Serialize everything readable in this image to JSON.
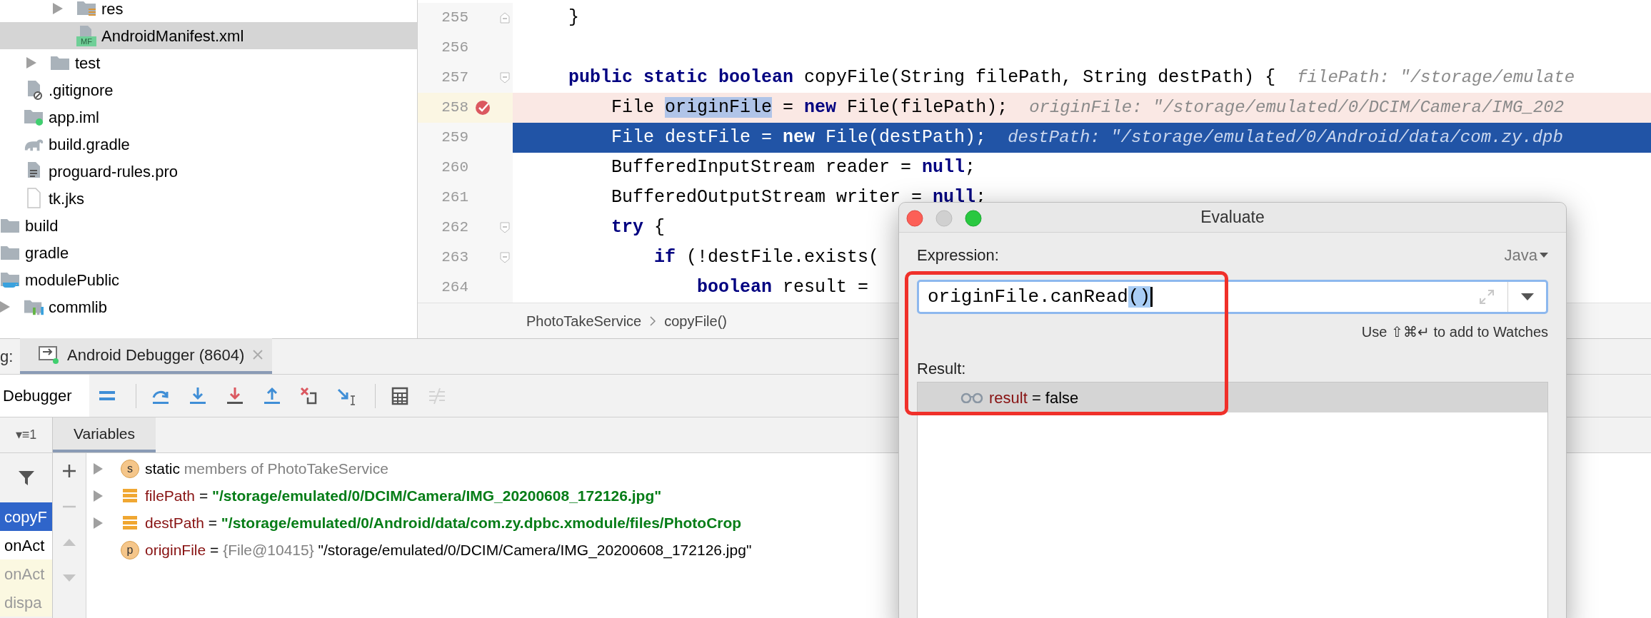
{
  "project_tree": [
    {
      "children": [
        {
          "children": [
            {
              "children": [
                {
                  "label": "res",
                  "kind": "res-folder",
                  "expanded": false,
                  "selected": false
                },
                {
                  "label": "AndroidManifest.xml",
                  "kind": "manifest",
                  "badge": "MF",
                  "selected": true
                }
              ]
            },
            {
              "label": "test",
              "kind": "folder",
              "expanded": false,
              "selected": false
            }
          ]
        },
        {
          "label": ".gitignore",
          "kind": "ignore-file",
          "selected": false
        },
        {
          "label": "app.iml",
          "kind": "module-file",
          "selected": false
        },
        {
          "label": "build.gradle",
          "kind": "gradle",
          "selected": false
        },
        {
          "label": "proguard-rules.pro",
          "kind": "text-file",
          "selected": false
        },
        {
          "label": "tk.jks",
          "kind": "blank-file",
          "selected": false
        }
      ]
    },
    {
      "label": "build",
      "kind": "folder",
      "selected": false
    },
    {
      "label": "gradle",
      "kind": "folder",
      "selected": false
    },
    {
      "label": "modulePublic",
      "kind": "module-folder",
      "selected": false,
      "children": [
        {
          "label": "commlib",
          "kind": "library-folder",
          "expanded": false,
          "selected": false
        }
      ]
    }
  ],
  "editor": {
    "lines": [
      {
        "number": "255",
        "kind": "normal",
        "fold_start": false,
        "fold_end": true,
        "parts": [
          {
            "text": "    }",
            "highlighted": false
          }
        ]
      },
      {
        "number": "256",
        "kind": "normal",
        "fold_start": false,
        "fold_end": false
      },
      {
        "number": "257",
        "kind": "normal",
        "fold_start": true,
        "fold_end": false,
        "parts": [
          {
            "text": "    **public static boolean** copyFile(String filePath, String destPath) {",
            "highlighted": false
          }
        ],
        "hint": "filePath: \"/storage/emulate"
      },
      {
        "number": "258",
        "kind": "breakpoint",
        "fold_start": false,
        "fold_end": false,
        "parts": [
          {
            "text": "        File ",
            "highlighted": false
          },
          {
            "text": "originFile",
            "highlighted": true
          },
          {
            "text": " = **new** File(filePath);",
            "highlighted": false
          }
        ],
        "hint": "originFile: \"/storage/emulated/0/DCIM/Camera/IMG_202"
      },
      {
        "number": "259",
        "kind": "current",
        "fold_start": false,
        "fold_end": false,
        "parts": [
          {
            "text": "        File destFile = **new** File(destPath);",
            "highlighted": false
          }
        ],
        "hint": "destPath: \"/storage/emulated/0/Android/data/com.zy.dpb"
      },
      {
        "number": "260",
        "kind": "normal",
        "fold_start": false,
        "fold_end": false,
        "parts": [
          {
            "text": "        BufferedInputStream reader = **null**;",
            "highlighted": false
          }
        ]
      },
      {
        "number": "261",
        "kind": "normal",
        "fold_start": false,
        "fold_end": false,
        "parts": [
          {
            "text": "        BufferedOutputStream writer = **null**;",
            "highlighted": false
          }
        ]
      },
      {
        "number": "262",
        "kind": "normal",
        "fold_start": true,
        "fold_end": false,
        "parts": [
          {
            "text": "        **try** {",
            "highlighted": false
          }
        ]
      },
      {
        "number": "263",
        "kind": "normal",
        "fold_start": true,
        "fold_end": false,
        "parts": [
          {
            "text": "            **if** (!destFile.exists(",
            "highlighted": false
          }
        ]
      },
      {
        "number": "264",
        "kind": "normal",
        "fold_start": false,
        "fold_end": false,
        "parts": [
          {
            "text": "                **boolean** result = ",
            "highlighted": false
          }
        ]
      }
    ],
    "breadcrumbs": [
      "PhotoTakeService",
      "copyFile()"
    ]
  },
  "debug_panel": {
    "title_fragment": "g:",
    "session_tab": {
      "label": "Android Debugger (8604)",
      "selected": true
    },
    "tabs": [
      {
        "label": "Debugger",
        "selected": true
      }
    ],
    "toolbar": [
      {
        "kind": "layout",
        "disabled": false
      },
      {
        "kind": "separator"
      },
      {
        "kind": "step-over",
        "disabled": false
      },
      {
        "kind": "step-into",
        "disabled": false
      },
      {
        "kind": "force-step-into",
        "disabled": false
      },
      {
        "kind": "step-out",
        "disabled": false
      },
      {
        "kind": "drop-frame",
        "disabled": false
      },
      {
        "kind": "run-to-cursor",
        "disabled": false
      },
      {
        "kind": "separator"
      },
      {
        "kind": "evaluate",
        "disabled": false
      },
      {
        "kind": "trace",
        "disabled": true
      }
    ],
    "threads_control": "▾≡1",
    "frames": [
      {
        "label": "copyF",
        "selected": true,
        "library": false
      },
      {
        "label": "onAct",
        "selected": false,
        "library": false
      },
      {
        "label": "onAct",
        "selected": false,
        "library": true
      },
      {
        "label": "dispa",
        "selected": false,
        "library": true
      }
    ],
    "variables_tab": {
      "label": "Variables",
      "selected": true
    },
    "variable_actions": [
      {
        "kind": "add",
        "disabled": false
      },
      {
        "kind": "remove",
        "disabled": true
      },
      {
        "kind": "up",
        "disabled": true
      },
      {
        "kind": "down",
        "disabled": true
      }
    ],
    "variables": [
      {
        "kind": "static",
        "badge": "s",
        "name": "static",
        "detail": "members of PhotoTakeService",
        "expanded": false
      },
      {
        "kind": "field",
        "name": "filePath",
        "operator": "=",
        "value": "\"/storage/emulated/0/DCIM/Camera/IMG_20200608_172126.jpg\"",
        "expanded": false
      },
      {
        "kind": "field",
        "name": "destPath",
        "operator": "=",
        "value": "\"/storage/emulated/0/Android/data/com.zy.dpbc.xmodule/files/PhotoCrop",
        "expanded": false
      },
      {
        "kind": "parameter",
        "badge": "p",
        "name": "originFile",
        "operator": "=",
        "ref": "{File@10415}",
        "value": "\"/storage/emulated/0/DCIM/Camera/IMG_20200608_172126.jpg\""
      }
    ]
  },
  "evaluate_dialog": {
    "title": "Evaluate",
    "expression_label": "Expression:",
    "language": "Java",
    "expression": {
      "parts": [
        {
          "text": "originFile.canRead",
          "highlighted": false
        },
        {
          "text": "()",
          "highlighted": true
        }
      ]
    },
    "hint": "Use ⇧⌘↵ to add to Watches",
    "result_label": "Result:",
    "results": [
      {
        "name": "result",
        "operator": "=",
        "value": "false",
        "selected": true
      }
    ]
  }
}
